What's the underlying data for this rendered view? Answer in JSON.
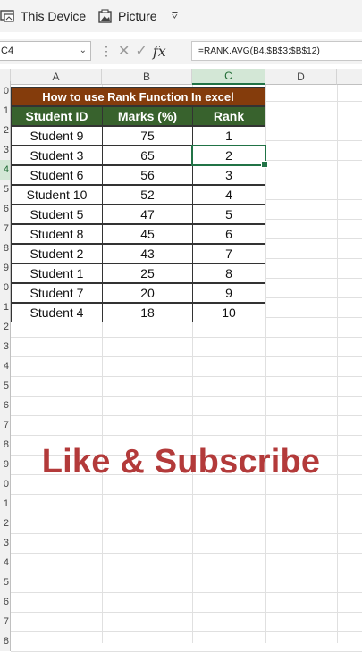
{
  "ribbon": {
    "items": [
      {
        "label": "This Device",
        "icon": "device-icon"
      },
      {
        "label": "Picture",
        "icon": "picture-icon"
      }
    ],
    "overflow_icon": "dropdown-more-icon"
  },
  "formula_bar": {
    "name_box": "C4",
    "formula": "=RANK.AVG(B4,$B$3:$B$12)"
  },
  "columns": [
    "A",
    "B",
    "C",
    "D"
  ],
  "active_column": "C",
  "row_headers": [
    "0",
    "1",
    "2",
    "3",
    "4",
    "5",
    "6",
    "7",
    "8",
    "9",
    "0",
    "1",
    "2",
    "3",
    "4",
    "5",
    "6",
    "7",
    "8",
    "9",
    "0",
    "1",
    "2",
    "3",
    "4",
    "5",
    "6",
    "7",
    "8"
  ],
  "active_row_index": 4,
  "table": {
    "title": "How to use Rank Function In excel",
    "headers": [
      "Student ID",
      "Marks (%)",
      "Rank"
    ],
    "rows": [
      {
        "student": "Student 9",
        "marks": "75",
        "rank": "1"
      },
      {
        "student": "Student 3",
        "marks": "65",
        "rank": "2"
      },
      {
        "student": "Student 6",
        "marks": "56",
        "rank": "3"
      },
      {
        "student": "Student 10",
        "marks": "52",
        "rank": "4"
      },
      {
        "student": "Student 5",
        "marks": "47",
        "rank": "5"
      },
      {
        "student": "Student 8",
        "marks": "45",
        "rank": "6"
      },
      {
        "student": "Student 2",
        "marks": "43",
        "rank": "7"
      },
      {
        "student": "Student 1",
        "marks": "25",
        "rank": "8"
      },
      {
        "student": "Student 7",
        "marks": "20",
        "rank": "9"
      },
      {
        "student": "Student 4",
        "marks": "18",
        "rank": "10"
      }
    ]
  },
  "overlay_text": "Like & Subscribe",
  "colors": {
    "title_bg": "#843c0c",
    "header_bg": "#38622d",
    "selection": "#217346",
    "overlay": "#b33a3a"
  }
}
